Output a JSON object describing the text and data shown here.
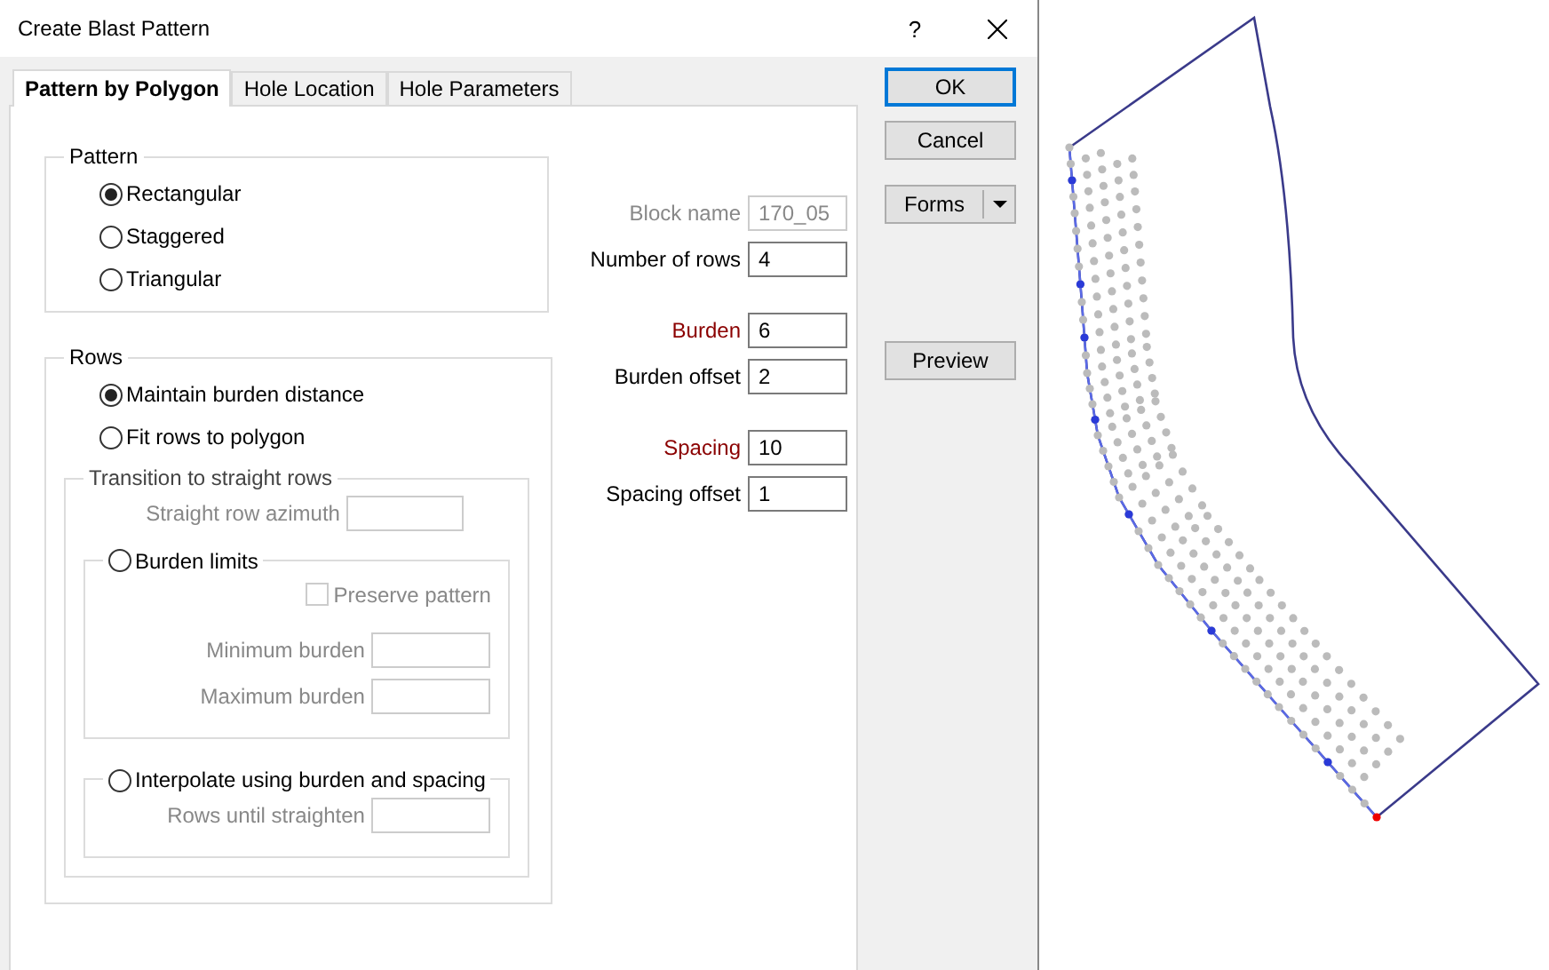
{
  "window": {
    "title": "Create Blast Pattern",
    "help": "?"
  },
  "tabs": [
    {
      "label": "Pattern by Polygon",
      "selected": true
    },
    {
      "label": "Hole Location",
      "selected": false
    },
    {
      "label": "Hole Parameters",
      "selected": false
    }
  ],
  "pattern": {
    "title": "Pattern",
    "options": [
      {
        "label": "Rectangular",
        "selected": true
      },
      {
        "label": "Staggered",
        "selected": false
      },
      {
        "label": "Triangular",
        "selected": false
      }
    ]
  },
  "rows": {
    "title": "Rows",
    "options": [
      {
        "label": "Maintain burden distance",
        "selected": true
      },
      {
        "label": "Fit rows to polygon",
        "selected": false
      }
    ],
    "transition": {
      "title": "Transition to straight rows",
      "disabled": true,
      "azimuth": {
        "label": "Straight row azimuth"
      },
      "burden_limits": {
        "label": "Burden limits",
        "selected": false,
        "preserve": {
          "label": "Preserve pattern",
          "checked": false
        },
        "fields": [
          {
            "label": "Minimum burden"
          },
          {
            "label": "Maximum burden"
          }
        ]
      },
      "interpolate": {
        "label": "Interpolate using burden and spacing",
        "selected": false,
        "fields": [
          {
            "label": "Rows until straighten"
          }
        ]
      }
    }
  },
  "field_groups": [
    [
      {
        "label": "Block name",
        "value": "170_05",
        "disabled": true
      },
      {
        "label": "Number of rows",
        "value": "4",
        "disabled": false,
        "required": false
      }
    ],
    [
      {
        "label": "Burden",
        "value": "6",
        "disabled": false,
        "required": true
      },
      {
        "label": "Burden offset",
        "value": "2",
        "disabled": false,
        "required": false
      }
    ],
    [
      {
        "label": "Spacing",
        "value": "10",
        "disabled": false,
        "required": true
      },
      {
        "label": "Spacing offset",
        "value": "1",
        "disabled": false,
        "required": false
      }
    ]
  ],
  "buttons": [
    {
      "label": "OK",
      "kind": "default"
    },
    {
      "label": "Cancel",
      "kind": "plain"
    },
    {
      "label": "Forms",
      "kind": "split"
    },
    {
      "label": "Preview",
      "kind": "plain"
    }
  ]
}
